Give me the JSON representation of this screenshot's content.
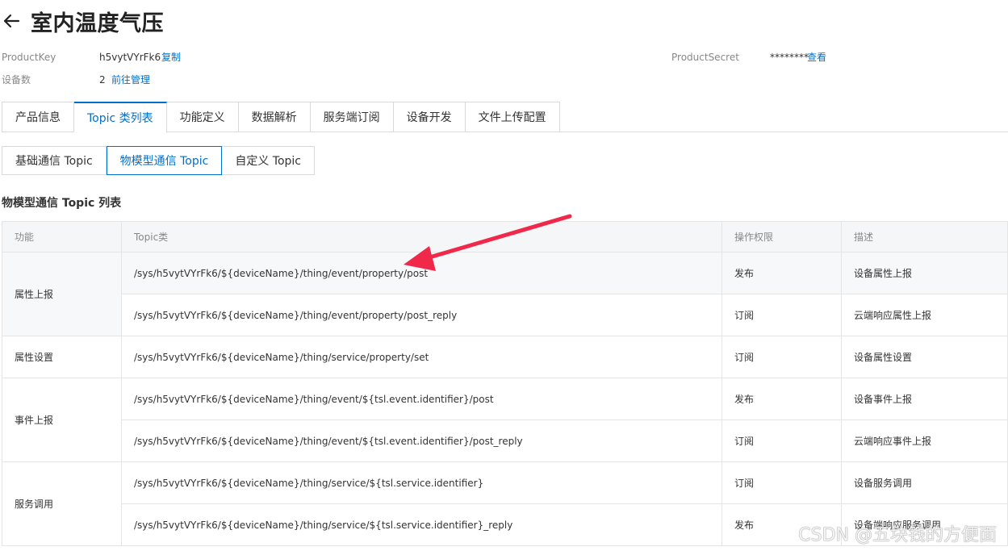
{
  "header": {
    "title": "室内温度气压"
  },
  "meta": {
    "product_key_label": "ProductKey",
    "product_key_value": "h5vytVYrFk6",
    "copy_label": "复制",
    "device_count_label": "设备数",
    "device_count_value": "2",
    "manage_label": "前往管理",
    "product_secret_label": "ProductSecret",
    "product_secret_value": "********",
    "view_label": "查看"
  },
  "tabs": [
    {
      "label": "产品信息"
    },
    {
      "label": "Topic 类列表"
    },
    {
      "label": "功能定义"
    },
    {
      "label": "数据解析"
    },
    {
      "label": "服务端订阅"
    },
    {
      "label": "设备开发"
    },
    {
      "label": "文件上传配置"
    }
  ],
  "subtabs": [
    {
      "label": "基础通信 Topic"
    },
    {
      "label": "物模型通信 Topic"
    },
    {
      "label": "自定义 Topic"
    }
  ],
  "section_title": "物模型通信 Topic 列表",
  "table": {
    "headers": {
      "func": "功能",
      "topic": "Topic类",
      "perm": "操作权限",
      "desc": "描述"
    },
    "groups": [
      {
        "func": "属性上报",
        "rows": [
          {
            "topic": "/sys/h5vytVYrFk6/${deviceName}/thing/event/property/post",
            "perm": "发布",
            "desc": "设备属性上报"
          },
          {
            "topic": "/sys/h5vytVYrFk6/${deviceName}/thing/event/property/post_reply",
            "perm": "订阅",
            "desc": "云端响应属性上报"
          }
        ]
      },
      {
        "func": "属性设置",
        "rows": [
          {
            "topic": "/sys/h5vytVYrFk6/${deviceName}/thing/service/property/set",
            "perm": "订阅",
            "desc": "设备属性设置"
          }
        ]
      },
      {
        "func": "事件上报",
        "rows": [
          {
            "topic": "/sys/h5vytVYrFk6/${deviceName}/thing/event/${tsl.event.identifier}/post",
            "perm": "发布",
            "desc": "设备事件上报"
          },
          {
            "topic": "/sys/h5vytVYrFk6/${deviceName}/thing/event/${tsl.event.identifier}/post_reply",
            "perm": "订阅",
            "desc": "云端响应事件上报"
          }
        ]
      },
      {
        "func": "服务调用",
        "rows": [
          {
            "topic": "/sys/h5vytVYrFk6/${deviceName}/thing/service/${tsl.service.identifier}",
            "perm": "订阅",
            "desc": "设备服务调用"
          },
          {
            "topic": "/sys/h5vytVYrFk6/${deviceName}/thing/service/${tsl.service.identifier}_reply",
            "perm": "发布",
            "desc": "设备端响应服务调用"
          }
        ]
      }
    ]
  },
  "watermark": "CSDN @五块钱的方便面",
  "colors": {
    "accent": "#0070cc",
    "arrow": "#f0284a"
  }
}
